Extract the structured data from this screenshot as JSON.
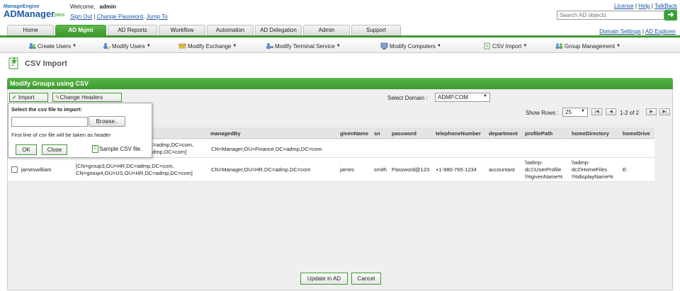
{
  "header": {
    "logo_top": "ManageEngine",
    "logo_main": "ADManager",
    "logo_plus": "plus",
    "welcome_label": "Welcome,",
    "username": "admin",
    "sign_out": "Sign Out",
    "change_password": "Change Password",
    "jump_to": "Jump To",
    "license": "License",
    "help": "Help",
    "talkback": "TalkBack",
    "search_placeholder": "Search AD objects"
  },
  "tabs": [
    {
      "label": "Home"
    },
    {
      "label": "AD Mgmt"
    },
    {
      "label": "AD Reports"
    },
    {
      "label": "Workflow"
    },
    {
      "label": "Automation"
    },
    {
      "label": "AD Delegation"
    },
    {
      "label": "Admin"
    },
    {
      "label": "Support"
    }
  ],
  "rightlinks": {
    "domain_settings": "Domain Settings",
    "ad_explorer": "AD Explorer"
  },
  "submenu": [
    {
      "label": "Create Users"
    },
    {
      "label": "Modify Users"
    },
    {
      "label": "Modify Exchange"
    },
    {
      "label": "Modify Terminal Service"
    },
    {
      "label": "Modify Computers"
    },
    {
      "label": "CSV Import"
    },
    {
      "label": "Group Management"
    }
  ],
  "page": {
    "title": "CSV Import",
    "panel_title": "Modify Groups using CSV",
    "import_label": "Import",
    "change_headers_label": "Change Headers",
    "select_domain_label": "Select Domain :",
    "domain_value": "ADMP.COM",
    "show_rows_label": "Show Rows :",
    "show_rows_value": "25",
    "page_info": "1-2 of 2",
    "update_button": "Update in AD",
    "cancel_button": "Cancel"
  },
  "popup": {
    "select_label": "Select the csv file to import:",
    "browse_label": "Browse..",
    "note": "First line of csv file will be taken as header",
    "ok_label": "OK",
    "cancel_label": "Close",
    "sample_label": "Sample CSV file."
  },
  "table": {
    "headers": [
      "managedBy",
      "givenName",
      "sn",
      "password",
      "telephoneNumber",
      "department",
      "profilePath",
      "homeDirectory",
      "homeDrive"
    ],
    "row1": {
      "member_line1": "C=admp,DC=com,",
      "member_line2": "admp,DC=com]",
      "managedBy": "CN=Manager,OU=Finance,DC=admp,DC=com"
    },
    "row2": {
      "name": "jameswilliam",
      "member_line1": "[CN=group3,OU=HR,DC=admp,DC=com,",
      "member_line2": "CN=group4,OU=US,OU=HR,DC=admp,DC=com]",
      "managedBy": "CN=Manager,OU=HR,DC=admp,DC=com",
      "givenName": "james",
      "sn": "smith",
      "password": "Password@123",
      "telephoneNumber": "+1-980-765-1234",
      "department": "accountant",
      "profilePath_1": "\\\\admp-",
      "profilePath_2": "dc1\\UserProfile",
      "profilePath_3": "\\%givenName%",
      "homeDirectory_1": "\\\\admp-",
      "homeDirectory_2": "dc2\\HomeFiles",
      "homeDirectory_3": "\\%displayName%",
      "homeDrive": "E:"
    }
  },
  "colors": {
    "accent": "#3e9930",
    "link": "#1a55a6"
  }
}
